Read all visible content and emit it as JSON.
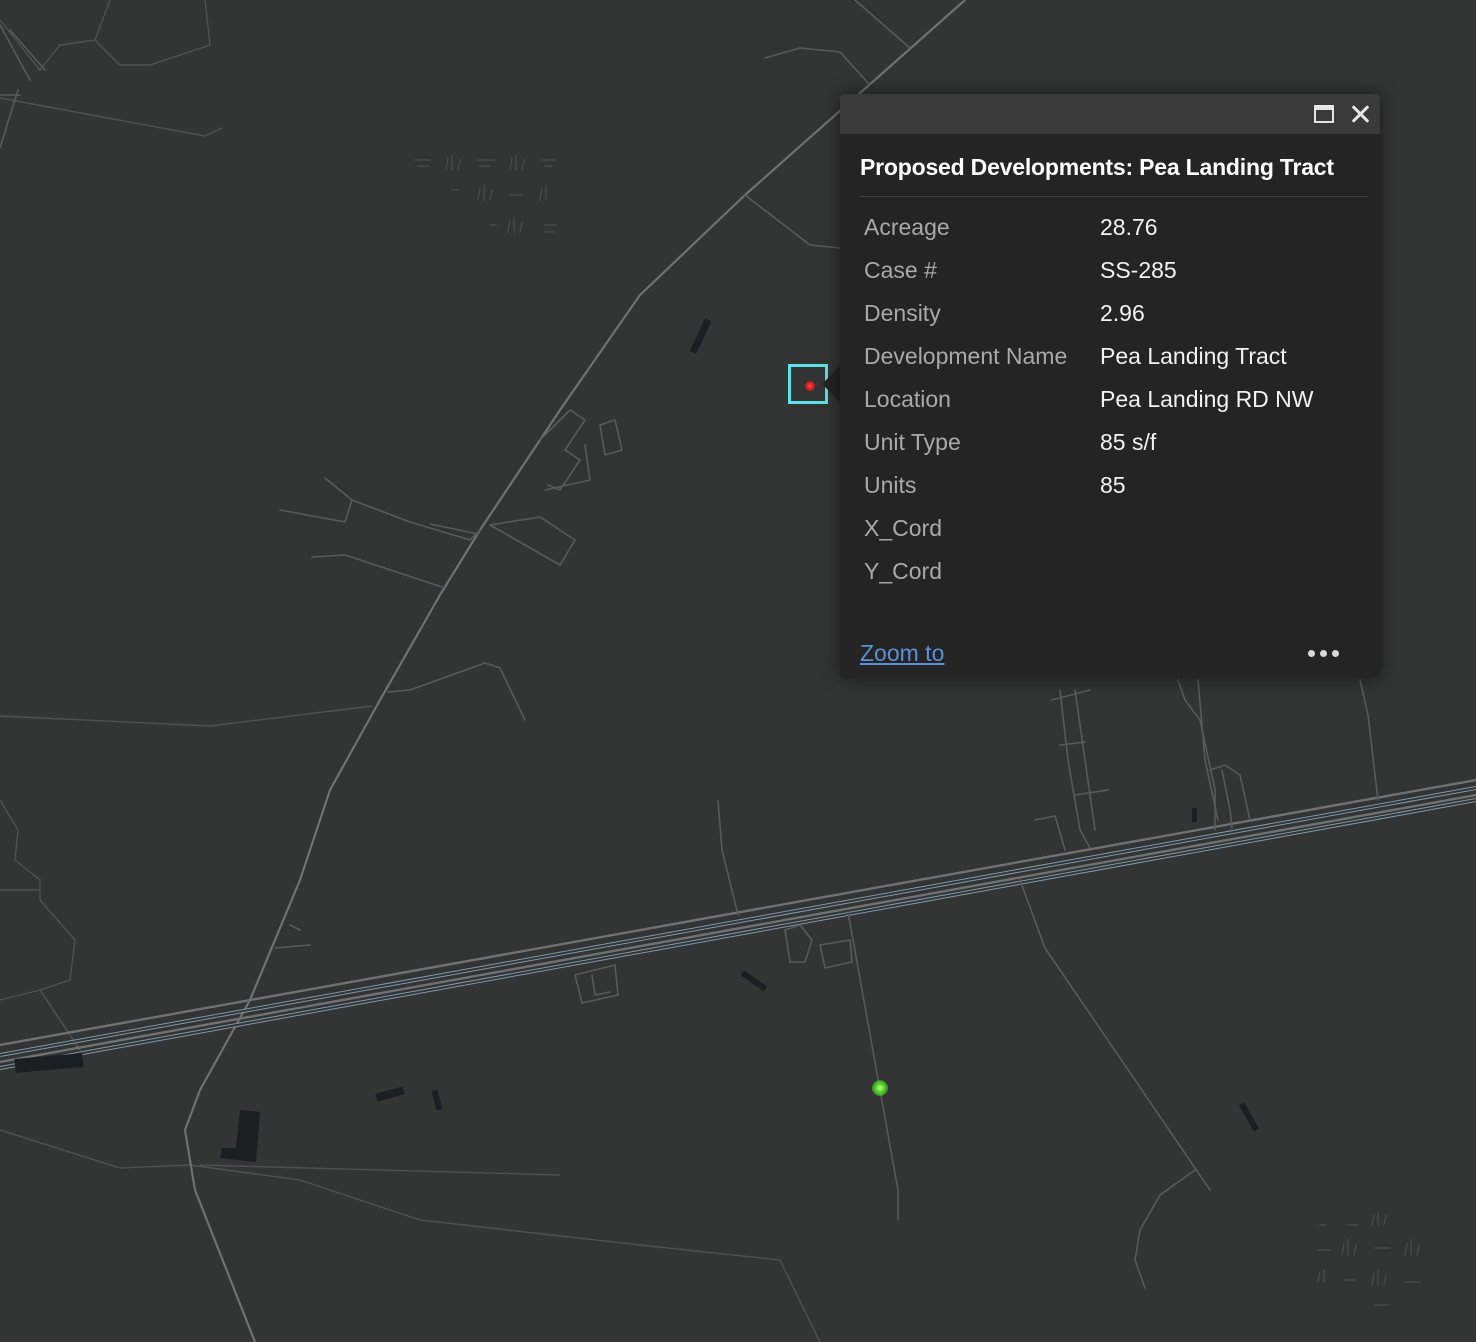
{
  "popup": {
    "title": "Proposed Developments: Pea Landing Tract",
    "attributes": [
      {
        "label": "Acreage",
        "value": "28.76"
      },
      {
        "label": "Case #",
        "value": "SS-285"
      },
      {
        "label": "Density",
        "value": "2.96"
      },
      {
        "label": "Development Name",
        "value": "Pea Landing Tract"
      },
      {
        "label": "Location",
        "value": "Pea Landing RD NW"
      },
      {
        "label": "Unit Type",
        "value": "85 s/f"
      },
      {
        "label": "Units",
        "value": "85"
      },
      {
        "label": "X_Cord",
        "value": ""
      },
      {
        "label": "Y_Cord",
        "value": ""
      }
    ],
    "zoom_label": "Zoom to",
    "header_icons": [
      "maximize-icon",
      "close-icon"
    ],
    "more_icon": "more-options-icon"
  },
  "map": {
    "basemap": "dark gray canvas",
    "selection_color": "#5ce1e6",
    "selected_point_color": "#d42a2a",
    "other_point_color": "#4fd128"
  }
}
